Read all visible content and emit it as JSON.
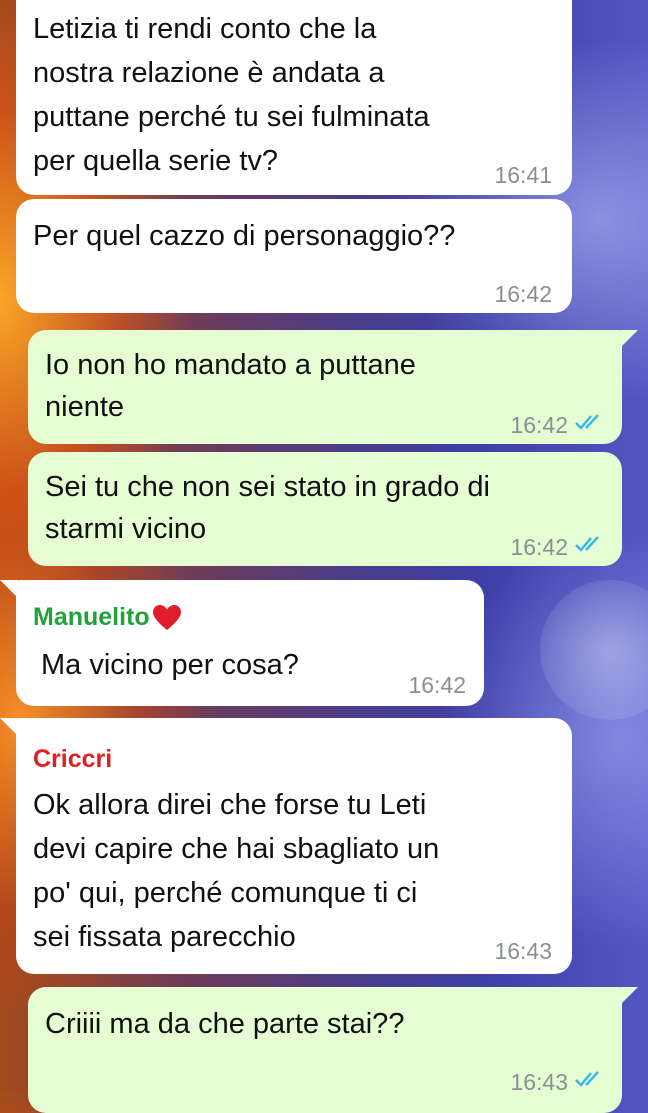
{
  "messages": [
    {
      "lines": [
        "Letizia ti rendi conto che la",
        "nostra relazione è andata a",
        "puttane perché tu sei fulminata",
        "per quella serie tv?"
      ],
      "time": "16:41"
    },
    {
      "lines": [
        "Per quel cazzo di personaggio??"
      ],
      "time": "16:42"
    },
    {
      "lines": [
        "Io non ho mandato a puttane",
        "niente"
      ],
      "time": "16:42",
      "status": "read-ticks-icon"
    },
    {
      "lines": [
        "Sei tu che non sei stato in grado di",
        "starmi vicino"
      ],
      "time": "16:42",
      "status": "read-ticks-icon"
    },
    {
      "sender": "Manuelito",
      "sender_color": "#1fa33a",
      "sender_emoji": "heart-icon",
      "lines": [
        "Ma vicino per cosa?"
      ],
      "time": "16:42"
    },
    {
      "sender": "Criccri",
      "sender_color": "#e02020",
      "lines": [
        "Ok allora direi che forse tu Leti",
        "devi capire che hai sbagliato un",
        "po' qui, perché comunque ti ci",
        "sei fissata parecchio"
      ],
      "time": "16:43"
    },
    {
      "lines": [
        "Criiii ma da che parte stai??"
      ],
      "time": "16:43",
      "status": "read-ticks-icon"
    }
  ],
  "colors": {
    "incoming": "#ffffff",
    "outgoing": "#e6fdd3",
    "read_ticks": "#34b7f1",
    "time_text": "#8a8f92"
  }
}
